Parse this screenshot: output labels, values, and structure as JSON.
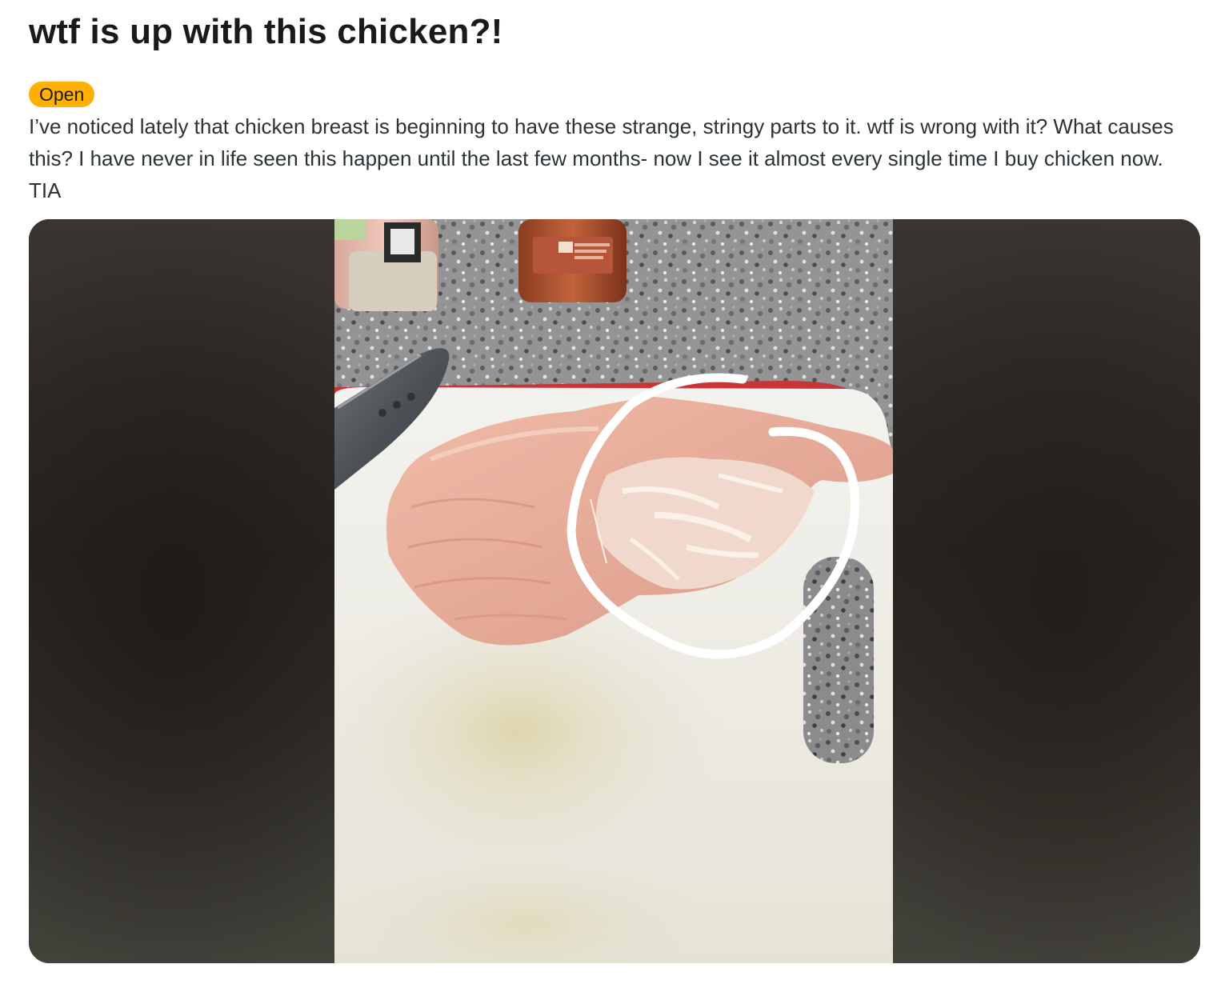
{
  "post": {
    "title": "wtf is up with this chicken?!",
    "flair": "Open",
    "body": "I’ve noticed lately that chicken breast is beginning to have these strange, stringy parts to it. wtf is wrong with it? What causes this? I have never in life seen this happen until the last few months- now I see it almost every single time I buy chicken now. TIA"
  },
  "colors": {
    "flair_bg": "#ffb000",
    "title": "#1a1a1b",
    "body": "#2a3236"
  },
  "media": {
    "image_icon": "photo-of-raw-chicken-breast"
  }
}
